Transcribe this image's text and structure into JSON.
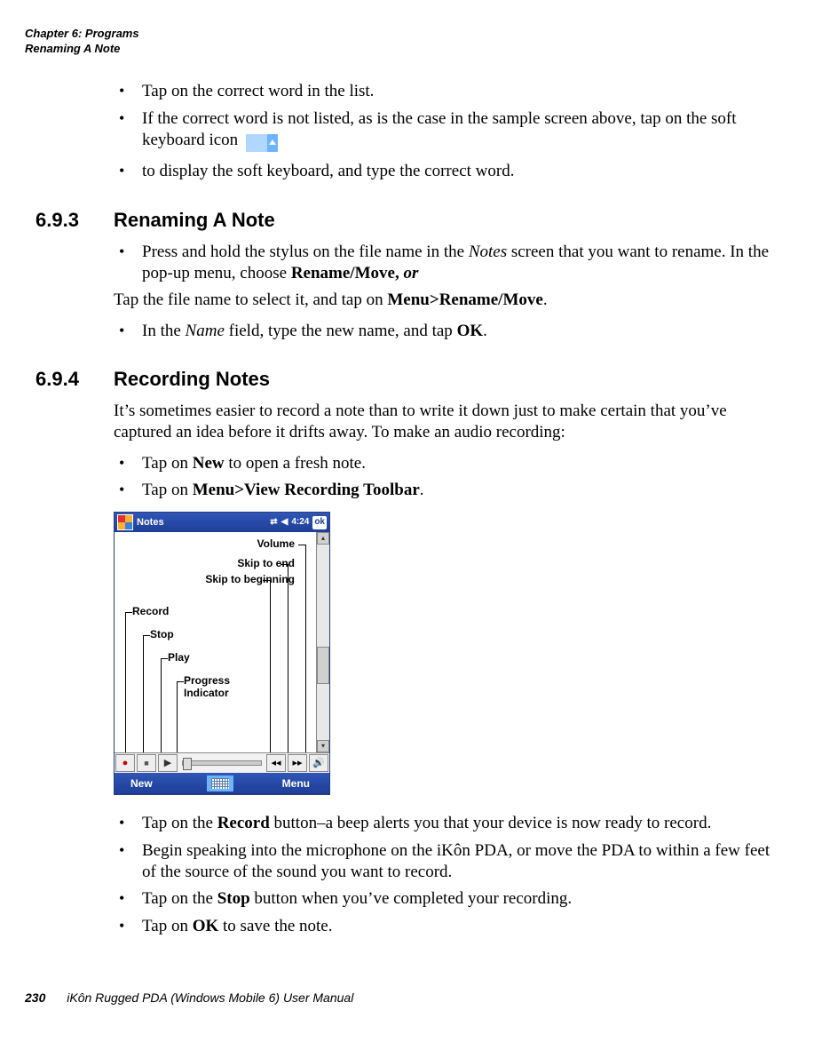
{
  "running_header": {
    "line1": "Chapter 6: Programs",
    "line2": "Renaming A Note"
  },
  "top_bullets": {
    "b1": "Tap on the correct word in the list.",
    "b2": "If the correct word is not listed, as is the case in the sample screen above, tap on the soft keyboard icon",
    "b3": " to display the soft keyboard, and type the correct word."
  },
  "section693": {
    "num": "6.9.3",
    "title": "Renaming A Note",
    "bul1a": "Press and hold the stylus on the file name in the ",
    "bul1b": "Notes",
    "bul1c": " screen that you want to rename. In the pop-up menu, choose ",
    "bul1d": "Rename/Move, ",
    "bul1e": "or",
    "para1a": "Tap the file name to select it, and tap on ",
    "para1b": "Menu>Rename/Move",
    "para1c": ".",
    "bul2a": "In the ",
    "bul2b": "Name",
    "bul2c": " field, type the new name, and tap ",
    "bul2d": "OK",
    "bul2e": "."
  },
  "section694": {
    "num": "6.9.4",
    "title": "Recording Notes",
    "intro": "It’s sometimes easier to record a note than to write it down just to make certain that you’ve captured an idea before it drifts away. To make an audio recording:",
    "bul1a": "Tap on ",
    "bul1b": "New",
    "bul1c": " to open a fresh note.",
    "bul2a": "Tap on ",
    "bul2b": "Menu>View Recording Toolbar",
    "bul2c": ".",
    "bul3a": "Tap on the ",
    "bul3b": "Record",
    "bul3c": " button–a beep alerts you that your device is now ready to record.",
    "bul4": "Begin speaking into the microphone on the iKôn PDA, or move the PDA to within a few feet of the source of the sound you want to record.",
    "bul5a": "Tap on the ",
    "bul5b": "Stop",
    "bul5c": " button when you’ve completed your recording.",
    "bul6a": "Tap on ",
    "bul6b": "OK",
    "bul6c": " to save the note."
  },
  "screenshot": {
    "app_title": "Notes",
    "clock": "4:24",
    "ok": "ok",
    "soft_left": "New",
    "soft_right": "Menu",
    "labels": {
      "volume": "Volume",
      "skip_end": "Skip to end",
      "skip_begin": "Skip to beginning",
      "record": "Record",
      "stop": "Stop",
      "play": "Play",
      "progress1": "Progress",
      "progress2": "Indicator"
    }
  },
  "footer": {
    "page": "230",
    "title": "iKôn Rugged PDA (Windows Mobile 6) User Manual"
  }
}
